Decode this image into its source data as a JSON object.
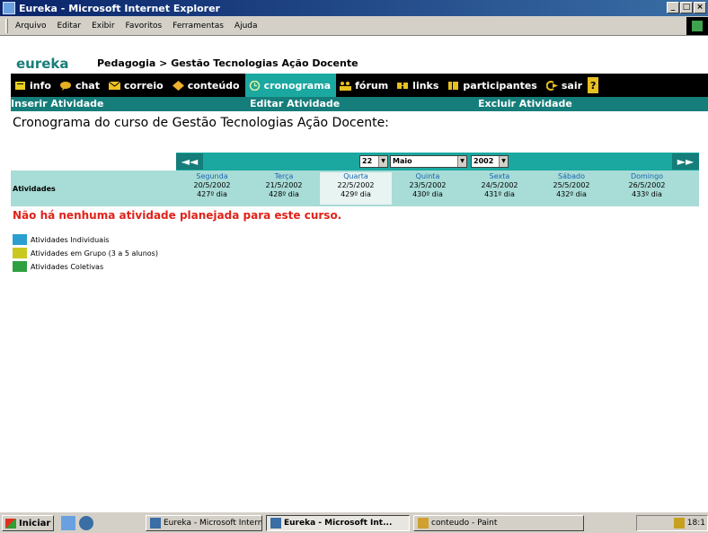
{
  "window": {
    "title": "Eureka - Microsoft Internet Explorer",
    "buttons": [
      "_",
      "□",
      "×"
    ]
  },
  "menu": [
    "Arquivo",
    "Editar",
    "Exibir",
    "Favoritos",
    "Ferramentas",
    "Ajuda"
  ],
  "header": {
    "logo": "eureka",
    "breadcrumb": "Pedagogia > Gestão Tecnologias Ação Docente"
  },
  "nav": {
    "items": [
      {
        "label": "info",
        "icon": "info-icon",
        "color": "#e8d020"
      },
      {
        "label": "chat",
        "icon": "chat-icon",
        "color": "#e8b020"
      },
      {
        "label": "correio",
        "icon": "mail-icon",
        "color": "#f0c020"
      },
      {
        "label": "conteúdo",
        "icon": "content-icon",
        "color": "#f0b030"
      },
      {
        "label": "cronograma",
        "icon": "clock-icon",
        "color": "#e8f0a0",
        "active": true
      },
      {
        "label": "fórum",
        "icon": "forum-icon",
        "color": "#e8c020"
      },
      {
        "label": "links",
        "icon": "links-icon",
        "color": "#e8c020"
      },
      {
        "label": "participantes",
        "icon": "people-icon",
        "color": "#e8c020"
      },
      {
        "label": "sair",
        "icon": "exit-icon",
        "color": "#e8c020"
      }
    ],
    "help_label": "?"
  },
  "actions": {
    "insert": "Inserir Atividade",
    "edit": "Editar Atividade",
    "delete": "Excluir Atividade"
  },
  "page_title": "Cronograma do curso de Gestão Tecnologias Ação Docente:",
  "calendar": {
    "prev": "◄◄",
    "next": "►►",
    "day_value": "22",
    "month_value": "Maio",
    "year_value": "2002",
    "column_header": "Atividades",
    "days": [
      {
        "name": "Segunda",
        "date": "20/5/2002",
        "num": "427º dia"
      },
      {
        "name": "Terça",
        "date": "21/5/2002",
        "num": "428º dia"
      },
      {
        "name": "Quarta",
        "date": "22/5/2002",
        "num": "429º dia",
        "today": true
      },
      {
        "name": "Quinta",
        "date": "23/5/2002",
        "num": "430º dia"
      },
      {
        "name": "Sexta",
        "date": "24/5/2002",
        "num": "431º dia"
      },
      {
        "name": "Sábado",
        "date": "25/5/2002",
        "num": "432º dia"
      },
      {
        "name": "Domingo",
        "date": "26/5/2002",
        "num": "433º dia"
      }
    ]
  },
  "empty_message": "Não há nenhuma atividade planejada para este curso.",
  "legend": [
    {
      "label": "Atividades Individuais",
      "color": "#2a9fd0"
    },
    {
      "label": "Atividades em Grupo (3 a 5 alunos)",
      "color": "#c8c820"
    },
    {
      "label": "Atividades Coletivas",
      "color": "#2ea040"
    }
  ],
  "taskbar": {
    "start": "Iniciar",
    "tasks": [
      {
        "label": "Eureka - Microsoft Internet...",
        "active": false
      },
      {
        "label": "Eureka - Microsoft Int...",
        "active": true
      },
      {
        "label": "conteudo - Paint",
        "active": false
      }
    ],
    "clock": "18:1"
  }
}
